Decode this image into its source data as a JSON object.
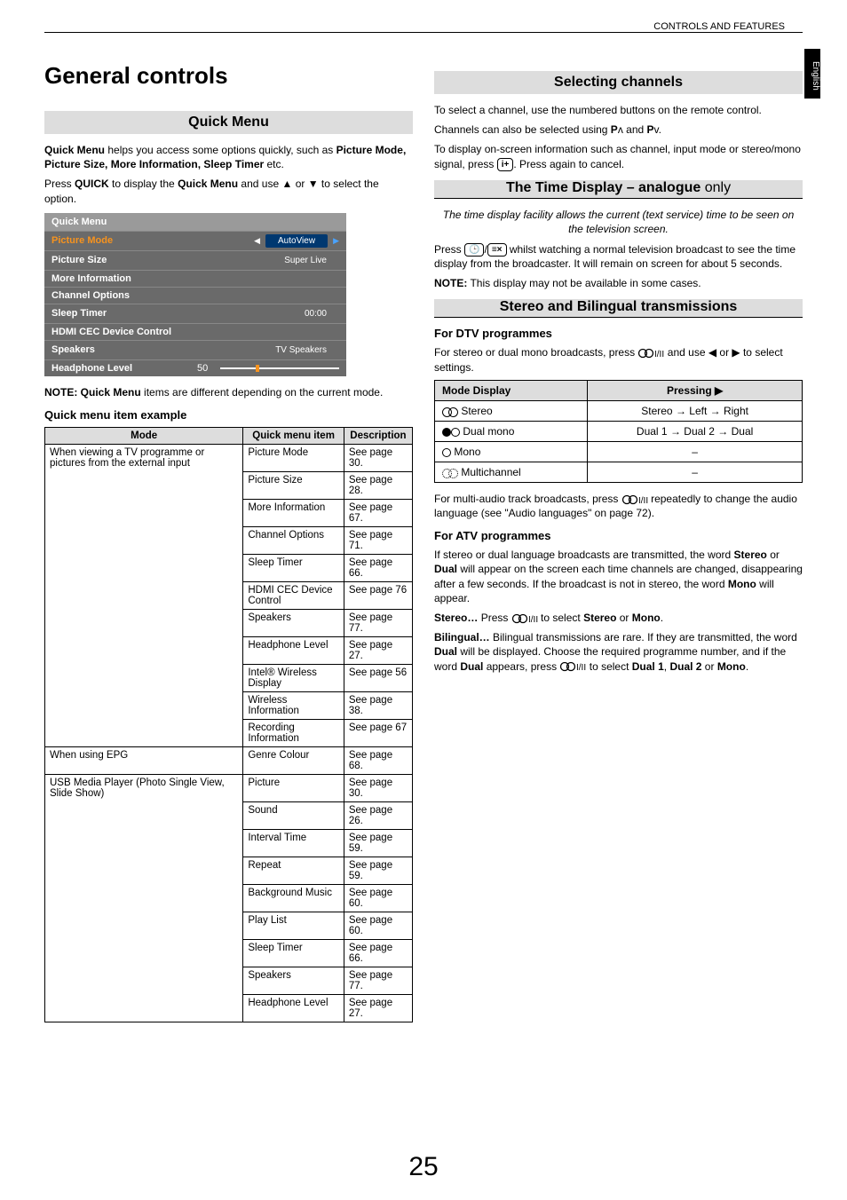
{
  "header": {
    "section": "CONTROLS AND FEATURES",
    "lang_tab": "English"
  },
  "page_number": "25",
  "left": {
    "h1": "General controls",
    "quick_menu_header": "Quick Menu",
    "p1_a": "Quick Menu",
    "p1_b": " helps you access some options quickly, such as ",
    "p1_c": "Picture Mode, Picture Size, More Information, Sleep Timer",
    "p1_d": " etc.",
    "p2_a": "Press ",
    "p2_b": "QUICK",
    "p2_c": " to display the ",
    "p2_d": "Quick Menu",
    "p2_e": " and use ",
    "p2_f": " or ",
    "p2_g": " to select the option.",
    "qm": {
      "title": "Quick Menu",
      "rows": {
        "pm_label": "Picture Mode",
        "pm_val": "AutoView",
        "ps_label": "Picture Size",
        "ps_val": "Super Live",
        "mi_label": "More Information",
        "co_label": "Channel Options",
        "st_label": "Sleep Timer",
        "st_val": "00:00",
        "hd_label": "HDMI CEC Device Control",
        "sp_label": "Speakers",
        "sp_val": "TV Speakers",
        "hl_label": "Headphone Level",
        "hl_val": "50"
      }
    },
    "note_a": "NOTE: Quick Menu",
    "note_b": " items are different depending on the current mode.",
    "example_head": "Quick menu item example",
    "t_head": {
      "c1": "Mode",
      "c2": "Quick menu item",
      "c3": "Description"
    },
    "tv_mode": "When viewing a TV programme or pictures from the external input",
    "epg_mode": "When using EPG",
    "usb_mode": "USB Media Player (Photo Single View, Slide Show)",
    "rows_tv": [
      {
        "i": "Picture Mode",
        "d": "See page 30."
      },
      {
        "i": "Picture Size",
        "d": "See page 28."
      },
      {
        "i": "More Information",
        "d": "See page 67."
      },
      {
        "i": "Channel Options",
        "d": "See page 71."
      },
      {
        "i": "Sleep Timer",
        "d": "See page 66."
      },
      {
        "i": "HDMI CEC Device Control",
        "d": "See page 76"
      },
      {
        "i": "Speakers",
        "d": "See page 77."
      },
      {
        "i": "Headphone  Level",
        "d": "See page 27."
      },
      {
        "i": "Intel® Wireless Display",
        "d": "See page 56"
      },
      {
        "i": "Wireless Information",
        "d": "See page 38."
      },
      {
        "i": "Recording Information",
        "d": "See page 67"
      }
    ],
    "rows_epg": [
      {
        "i": "Genre Colour",
        "d": "See page 68."
      }
    ],
    "rows_usb": [
      {
        "i": "Picture",
        "d": "See page 30."
      },
      {
        "i": "Sound",
        "d": "See page 26."
      },
      {
        "i": "Interval Time",
        "d": "See page 59."
      },
      {
        "i": "Repeat",
        "d": "See page 59."
      },
      {
        "i": "Background Music",
        "d": "See page 60."
      },
      {
        "i": "Play List",
        "d": "See page 60."
      },
      {
        "i": "Sleep Timer",
        "d": "See page 66."
      },
      {
        "i": "Speakers",
        "d": "See page 77."
      },
      {
        "i": "Headphone  Level",
        "d": "See page 27."
      }
    ]
  },
  "right": {
    "sel_header": "Selecting channels",
    "sel_p1": "To select a channel, use the numbered buttons on the remote control.",
    "sel_p2_a": "Channels can also be selected using ",
    "sel_p2_b": " and ",
    "sel_p2_p": "P",
    "sel_p3_a": "To display on-screen information such as channel, input mode or stereo/mono signal, press ",
    "sel_p3_b": ". Press again to cancel.",
    "time_header_a": "The Time Display – ",
    "time_header_b": "analogue",
    "time_header_c": " only",
    "time_italic": "The time display facility allows the current (text service) time to be seen on the television screen.",
    "time_p1_a": "Press ",
    "time_p1_b": " whilst watching a normal television broadcast to see the time display from the broadcaster. It will remain on screen for about 5 seconds.",
    "time_note_a": "NOTE:",
    "time_note_b": " This display may not be available in some cases.",
    "stereo_header": "Stereo and Bilingual transmissions",
    "dtv_head": "For DTV programmes",
    "dtv_p1_a": "For stereo or dual mono broadcasts, press ",
    "dtv_p1_b": " and use ",
    "dtv_p1_c": " or ",
    "dtv_p1_d": " to select settings.",
    "mt_head": {
      "c1": "Mode Display",
      "c2": "Pressing"
    },
    "mt_rows": {
      "stereo": "Stereo",
      "stereo_v": "Stereo → Left → Right",
      "dual": "Dual mono",
      "dual_v": "Dual 1 → Dual 2 → Dual",
      "mono": "Mono",
      "mono_v": "–",
      "multi": "Multichannel",
      "multi_v": "–"
    },
    "dtv_p2_a": "For multi-audio track broadcasts, press ",
    "dtv_p2_b": " repeatedly to change the audio language (see \"Audio languages\" on page 72).",
    "atv_head": "For ATV programmes",
    "atv_p1_a": "If stereo or dual language broadcasts are transmitted, the word ",
    "atv_p1_b": "Stereo",
    "atv_p1_c": " or ",
    "atv_p1_d": "Dual",
    "atv_p1_e": " will appear on the screen each time channels are changed, disappearing after a few seconds. If the broadcast is not in stereo, the word ",
    "atv_p1_f": "Mono",
    "atv_p1_g": " will appear.",
    "atv_p2_a": "Stereo…",
    "atv_p2_b": " Press ",
    "atv_p2_c": " to select ",
    "atv_p2_d": "Stereo",
    "atv_p2_e": " or ",
    "atv_p2_f": "Mono",
    "atv_p3_a": "Bilingual…",
    "atv_p3_b": " Bilingual transmissions are rare. If they are transmitted, the word ",
    "atv_p3_c": "Dual",
    "atv_p3_d": " will be displayed. Choose the required programme number, and if the word ",
    "atv_p3_e": "Dual",
    "atv_p3_f": " appears, press ",
    "atv_p3_g": " to select ",
    "atv_p3_h": "Dual 1",
    "atv_p3_i": "Dual 2",
    "atv_p3_j": " or ",
    "atv_p3_k": "Mono"
  }
}
